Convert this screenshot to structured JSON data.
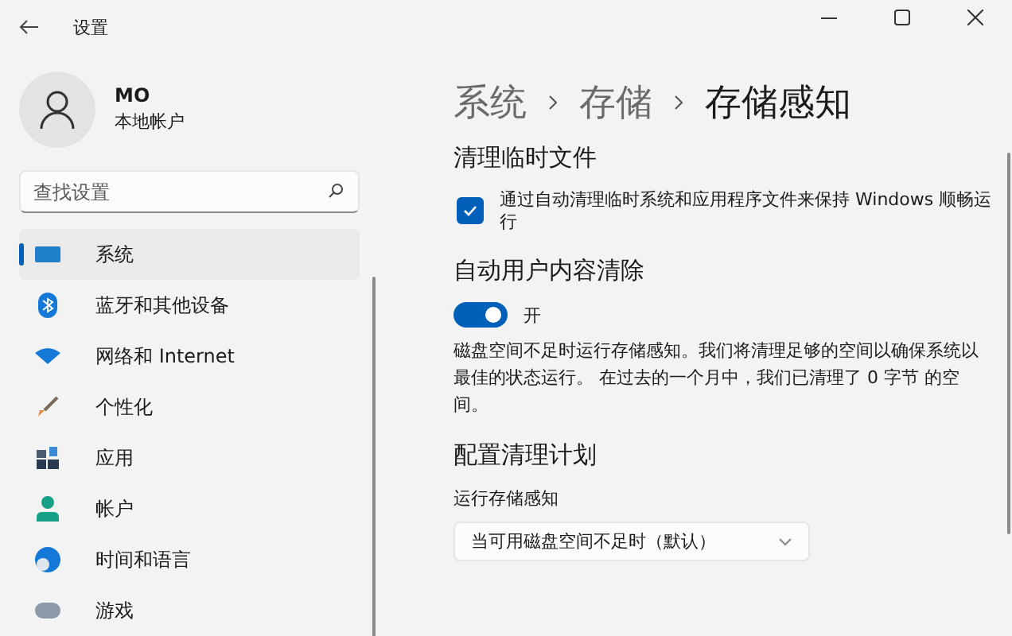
{
  "window": {
    "title": "设置"
  },
  "account": {
    "name": "MO",
    "type": "本地帐户"
  },
  "search": {
    "placeholder": "查找设置"
  },
  "sidebar": {
    "items": [
      {
        "label": "系统",
        "selected": true
      },
      {
        "label": "蓝牙和其他设备",
        "selected": false
      },
      {
        "label": "网络和 Internet",
        "selected": false
      },
      {
        "label": "个性化",
        "selected": false
      },
      {
        "label": "应用",
        "selected": false
      },
      {
        "label": "帐户",
        "selected": false
      },
      {
        "label": "时间和语言",
        "selected": false
      },
      {
        "label": "游戏",
        "selected": false
      }
    ]
  },
  "breadcrumb": [
    "系统",
    "存储",
    "存储感知"
  ],
  "sections": [
    {
      "kind": "checkbox",
      "heading": "清理临时文件",
      "label": "通过自动清理临时系统和应用程序文件来保持 Windows 顺畅运行",
      "checked": true
    },
    {
      "kind": "toggle",
      "heading": "自动用户内容清除",
      "state_label": "开",
      "on": true,
      "description": "磁盘空间不足时运行存储感知。我们将清理足够的空间以确保系统以最佳的状态运行。 在过去的一个月中，我们已清理了 0 字节 的空间。"
    },
    {
      "kind": "dropdown",
      "heading": "配置清理计划",
      "label": "运行存储感知",
      "value": "当可用磁盘空间不足时（默认）"
    }
  ]
}
